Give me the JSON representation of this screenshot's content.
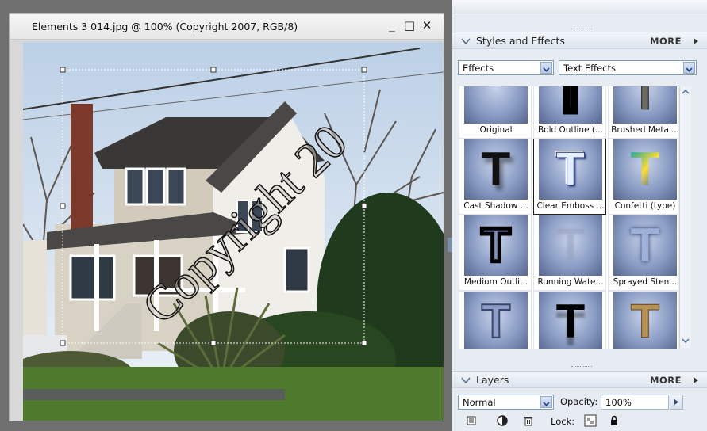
{
  "document": {
    "title": "Elements 3 014.jpg @ 100% (Copyright 2007, RGB/8)",
    "minimize": "_",
    "maximize": "□",
    "close": "✕",
    "watermark_text": "Copyright 20"
  },
  "styles_panel": {
    "title": "Styles and Effects",
    "more_label": "MORE",
    "category_select": "Effects",
    "library_select": "Text Effects",
    "effects": [
      {
        "label": "Original",
        "icon": "apple-thumbnail-icon",
        "selected": false
      },
      {
        "label": "Bold Outline (...",
        "icon": "bold-outline-t-icon",
        "selected": false
      },
      {
        "label": "Brushed Metal...",
        "icon": "brushed-metal-t-icon",
        "selected": false
      },
      {
        "label": "Cast Shadow ...",
        "icon": "cast-shadow-t-icon",
        "selected": false
      },
      {
        "label": "Clear Emboss ...",
        "icon": "clear-emboss-t-icon",
        "selected": true
      },
      {
        "label": "Confetti (type)",
        "icon": "confetti-t-icon",
        "selected": false
      },
      {
        "label": "Medium Outli...",
        "icon": "medium-outline-t-icon",
        "selected": false
      },
      {
        "label": "Running Wate...",
        "icon": "running-water-t-icon",
        "selected": false
      },
      {
        "label": "Sprayed Sten...",
        "icon": "sprayed-stencil-t-icon",
        "selected": false
      },
      {
        "label": "",
        "icon": "thin-outline-t-icon",
        "selected": false
      },
      {
        "label": "",
        "icon": "water-reflection-t-icon",
        "selected": false
      },
      {
        "label": "",
        "icon": "wood-t-icon",
        "selected": false
      }
    ]
  },
  "layers_panel": {
    "title": "Layers",
    "more_label": "MORE",
    "blend_mode": "Normal",
    "opacity_label": "Opacity:",
    "opacity_value": "100%",
    "lock_label": "Lock:"
  },
  "colors": {
    "panel_bg": "#e7ecf2",
    "accent": "#7f9db9",
    "workspace": "#6f6f6f"
  }
}
